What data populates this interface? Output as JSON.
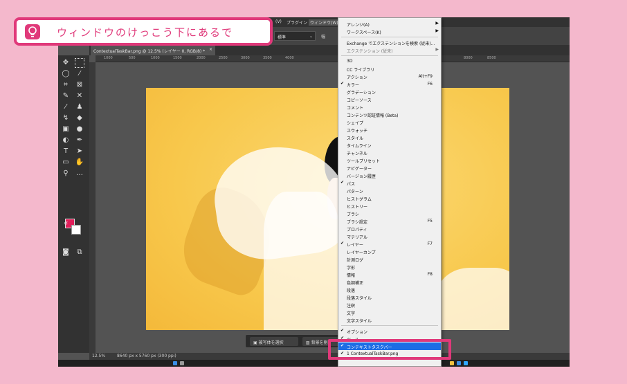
{
  "callout": {
    "text": "ウィンドウのけっこう下にあるで",
    "icon": "lightbulb-icon",
    "color": "#e0397a"
  },
  "menubar": {
    "items": [
      "(V)",
      "プラグイン",
      "ウィンドウ(W)"
    ]
  },
  "options": {
    "mode_value": "標準",
    "label": "幅"
  },
  "document_tab": {
    "title": "ContextualTaskBar.png @ 12.5% (レイヤー 0, RGB/8) *",
    "close": "×"
  },
  "ruler": {
    "marks": [
      "1000",
      "500",
      "1000",
      "1500",
      "2000",
      "2500",
      "3000",
      "3500",
      "4000",
      "8000",
      "8500"
    ]
  },
  "contextual_taskbar": {
    "select_subject": "被写体を選択",
    "remove_background": "背景を削"
  },
  "status": {
    "zoom": "12.5%",
    "doc_size": "8640 px x 5760 px (300 ppi)"
  },
  "window_menu": {
    "items": [
      {
        "label": "アレンジ(A)",
        "submenu": true
      },
      {
        "label": "ワークスペース(K)",
        "submenu": true
      },
      {
        "sep": true
      },
      {
        "label": "Exchange でエクステンションを検索 (従来)..."
      },
      {
        "label": "エクステンション (従来)",
        "submenu": true,
        "dim": true
      },
      {
        "sep": true
      },
      {
        "label": "3D"
      },
      {
        "label": "CC ライブラリ"
      },
      {
        "label": "アクション",
        "shortcut": "Alt+F9"
      },
      {
        "label": "カラー",
        "shortcut": "F6",
        "checked": true
      },
      {
        "label": "グラデーション"
      },
      {
        "label": "コピーソース"
      },
      {
        "label": "コメント"
      },
      {
        "label": "コンテンツ認証情報 (Beta)"
      },
      {
        "label": "シェイプ"
      },
      {
        "label": "スウォッチ"
      },
      {
        "label": "スタイル"
      },
      {
        "label": "タイムライン"
      },
      {
        "label": "チャンネル"
      },
      {
        "label": "ツールプリセット"
      },
      {
        "label": "ナビゲーター"
      },
      {
        "label": "バージョン履歴"
      },
      {
        "label": "パス",
        "checked": true
      },
      {
        "label": "パターン"
      },
      {
        "label": "ヒストグラム"
      },
      {
        "label": "ヒストリー"
      },
      {
        "label": "ブラシ"
      },
      {
        "label": "ブラシ設定",
        "shortcut": "F5"
      },
      {
        "label": "プロパティ"
      },
      {
        "label": "マテリアル"
      },
      {
        "label": "レイヤー",
        "shortcut": "F7",
        "checked": true
      },
      {
        "label": "レイヤーカンプ"
      },
      {
        "label": "計測ログ"
      },
      {
        "label": "字形"
      },
      {
        "label": "情報",
        "shortcut": "F8"
      },
      {
        "label": "色調補正"
      },
      {
        "label": "段落"
      },
      {
        "label": "段落スタイル"
      },
      {
        "label": "注釈"
      },
      {
        "label": "文字"
      },
      {
        "label": "文字スタイル"
      },
      {
        "sep": true
      },
      {
        "label": "オプション",
        "checked": true
      },
      {
        "label": "ツール",
        "checked": true
      },
      {
        "label": "コンテキストタスクバー",
        "checked": true,
        "selected": true
      },
      {
        "label": "1 ContextualTaskBar.png",
        "checked": true
      }
    ],
    "checkmark": "✔",
    "submenu_arrow": "▶"
  },
  "tools": {
    "icons": [
      "move-icon",
      "marquee-icon",
      "lasso-icon",
      "magic-wand-icon",
      "crop-icon",
      "frame-icon",
      "eyedropper-icon",
      "healing-icon",
      "brush-icon",
      "stamp-icon",
      "history-brush-icon",
      "eraser-icon",
      "gradient-icon",
      "blur-icon",
      "dodge-icon",
      "pen-icon",
      "type-icon",
      "path-select-icon",
      "shape-icon",
      "hand-icon",
      "zoom-icon",
      "more-icon"
    ],
    "foreground": "#e01e5a",
    "background": "#ffffff"
  }
}
